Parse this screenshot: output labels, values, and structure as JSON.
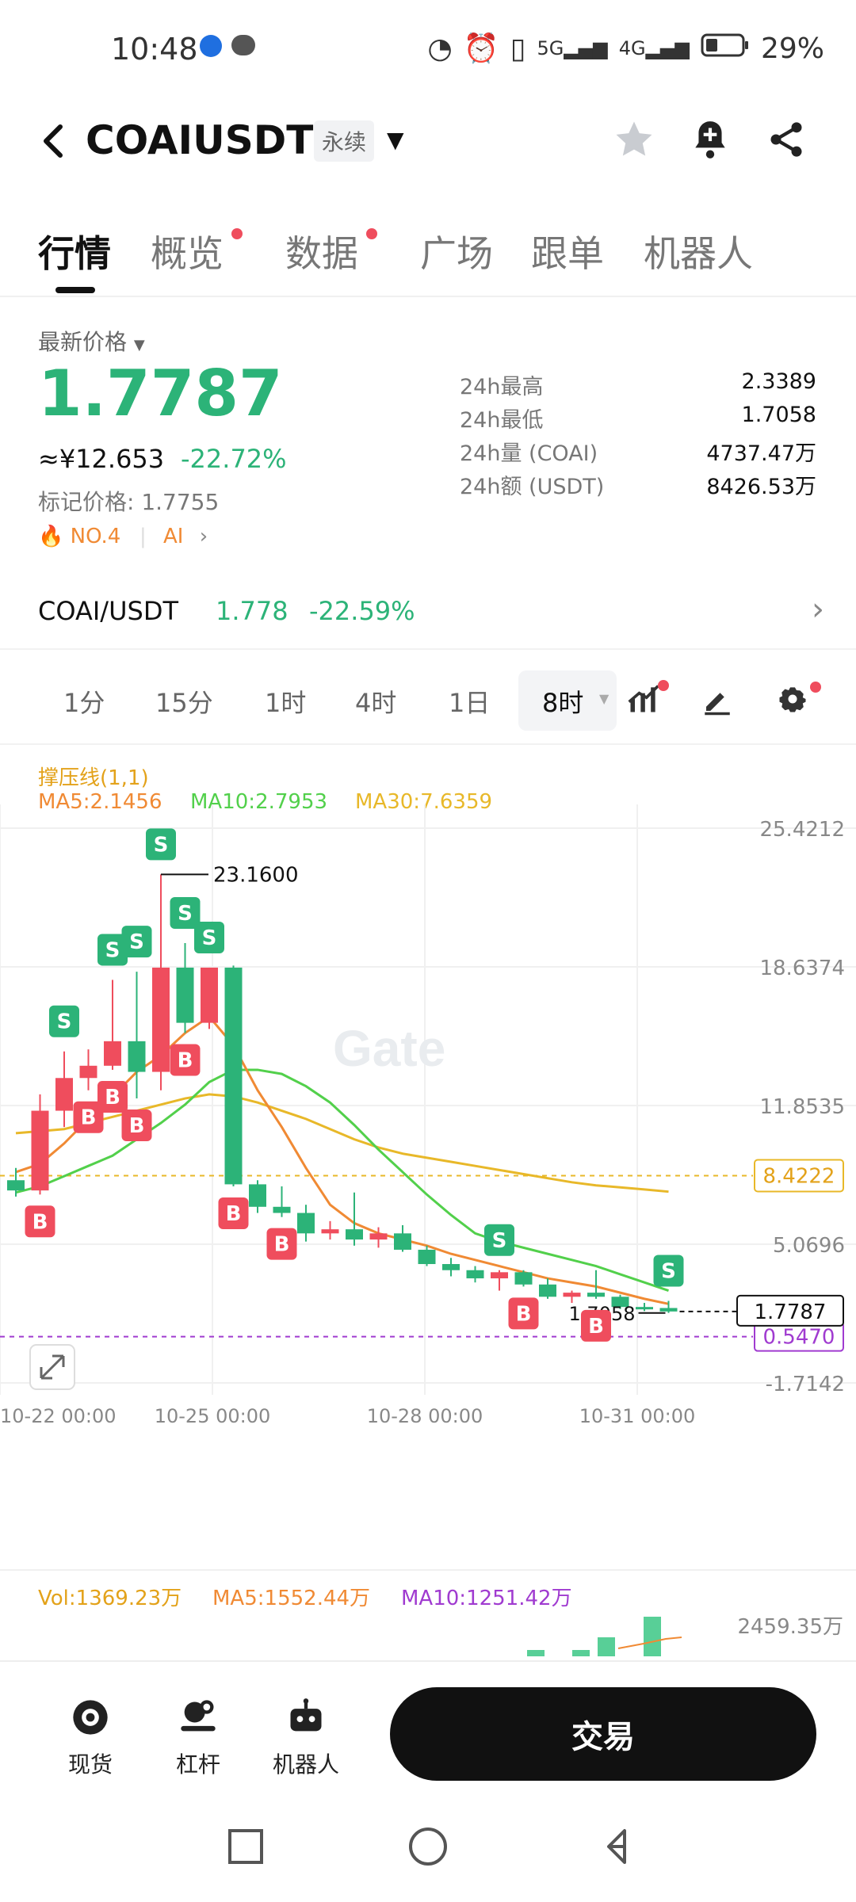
{
  "status_bar": {
    "time": "10:48",
    "battery": "29%"
  },
  "header": {
    "title": "COAIUSDT",
    "badge": "永续"
  },
  "tabs": [
    {
      "label": "行情",
      "active": true,
      "dot": false
    },
    {
      "label": "概览",
      "active": false,
      "dot": true
    },
    {
      "label": "数据",
      "active": false,
      "dot": true
    },
    {
      "label": "广场",
      "active": false,
      "dot": false
    },
    {
      "label": "跟单",
      "active": false,
      "dot": false
    },
    {
      "label": "机器人",
      "active": false,
      "dot": false
    }
  ],
  "price": {
    "latest_label": "最新价格",
    "value": "1.7787",
    "cny": "≈¥12.653",
    "change": "-22.72%",
    "mark_price": "标记价格: 1.7755",
    "tag_rank": "NO.4",
    "tag_sector": "AI"
  },
  "stats": [
    {
      "label": "24h最高",
      "value": "2.3389"
    },
    {
      "label": "24h最低",
      "value": "1.7058"
    },
    {
      "label": "24h量 (COAI)",
      "value": "4737.47万"
    },
    {
      "label": "24h额 (USDT)",
      "value": "8426.53万"
    }
  ],
  "spot": {
    "pair": "COAI/USDT",
    "price": "1.778",
    "change": "-22.59%"
  },
  "timeframes": [
    "1分",
    "15分",
    "1时",
    "4时",
    "1日",
    "8时"
  ],
  "active_timeframe": "8时",
  "indicators": {
    "sr_label": "撑压线(1,1)",
    "ma5": "MA5:2.1456",
    "ma10": "MA10:2.7953",
    "ma30": "MA30:7.6359"
  },
  "volume_indicators": {
    "vol": "Vol:1369.23万",
    "ma5": "MA5:1552.44万",
    "ma10": "MA10:1251.42万",
    "axis_top": "2459.35万"
  },
  "bottom": {
    "spot": "现货",
    "leverage": "杠杆",
    "robot": "机器人",
    "trade": "交易"
  },
  "watermark": "Gate",
  "colors": {
    "up": "#2cb378",
    "down": "#ef4d5d",
    "accent_orange": "#f08a34"
  },
  "chart_data": {
    "type": "candlestick",
    "y_axis_ticks": [
      "25.4212",
      "18.6374",
      "11.8535",
      "5.0696",
      "-1.7142"
    ],
    "x_axis_ticks": [
      "10-22 00:00",
      "10-25 00:00",
      "10-28 00:00",
      "10-31 00:00"
    ],
    "high_label": "23.1600",
    "low_label": "1.7058",
    "current_price_label": "1.7787",
    "support_line_label": "8.4222",
    "purple_line_label": "0.5470",
    "ylim": [
      -1.7142,
      25.4212
    ],
    "candles": [
      {
        "o": 8.2,
        "h": 8.8,
        "l": 7.4,
        "c": 7.7
      },
      {
        "o": 7.7,
        "h": 12.4,
        "l": 7.5,
        "c": 11.6
      },
      {
        "o": 11.6,
        "h": 14.5,
        "l": 10.8,
        "c": 13.2
      },
      {
        "o": 13.2,
        "h": 14.6,
        "l": 12.6,
        "c": 13.8
      },
      {
        "o": 13.8,
        "h": 18.0,
        "l": 13.6,
        "c": 15.0
      },
      {
        "o": 15.0,
        "h": 18.4,
        "l": 12.2,
        "c": 13.5
      },
      {
        "o": 13.5,
        "h": 23.16,
        "l": 12.6,
        "c": 18.6
      },
      {
        "o": 18.6,
        "h": 19.8,
        "l": 15.4,
        "c": 15.9
      },
      {
        "o": 15.9,
        "h": 18.6,
        "l": 15.6,
        "c": 18.6
      },
      {
        "o": 18.6,
        "h": 18.7,
        "l": 7.9,
        "c": 8.0
      },
      {
        "o": 8.0,
        "h": 8.2,
        "l": 6.6,
        "c": 6.9
      },
      {
        "o": 6.9,
        "h": 7.9,
        "l": 6.4,
        "c": 6.6
      },
      {
        "o": 6.6,
        "h": 7.0,
        "l": 5.2,
        "c": 5.6
      },
      {
        "o": 5.6,
        "h": 6.2,
        "l": 5.3,
        "c": 5.8
      },
      {
        "o": 5.8,
        "h": 7.6,
        "l": 5.0,
        "c": 5.3
      },
      {
        "o": 5.3,
        "h": 5.9,
        "l": 4.9,
        "c": 5.6
      },
      {
        "o": 5.6,
        "h": 6.0,
        "l": 4.7,
        "c": 4.8
      },
      {
        "o": 4.8,
        "h": 5.0,
        "l": 4.0,
        "c": 4.1
      },
      {
        "o": 4.1,
        "h": 4.4,
        "l": 3.5,
        "c": 3.8
      },
      {
        "o": 3.8,
        "h": 4.0,
        "l": 3.2,
        "c": 3.4
      },
      {
        "o": 3.4,
        "h": 3.8,
        "l": 2.8,
        "c": 3.7
      },
      {
        "o": 3.7,
        "h": 3.8,
        "l": 3.0,
        "c": 3.1
      },
      {
        "o": 3.1,
        "h": 3.4,
        "l": 2.4,
        "c": 2.5
      },
      {
        "o": 2.5,
        "h": 2.8,
        "l": 2.2,
        "c": 2.7
      },
      {
        "o": 2.7,
        "h": 3.8,
        "l": 2.4,
        "c": 2.5
      },
      {
        "o": 2.5,
        "h": 2.6,
        "l": 1.9,
        "c": 2.0
      },
      {
        "o": 2.0,
        "h": 2.2,
        "l": 1.8,
        "c": 1.95
      },
      {
        "o": 1.95,
        "h": 2.3,
        "l": 1.71,
        "c": 1.78
      }
    ],
    "ma5": [
      8.6,
      9.0,
      10.0,
      11.2,
      12.3,
      13.5,
      14.3,
      15.4,
      16.2,
      14.8,
      12.6,
      10.8,
      8.8,
      7.0,
      6.1,
      5.6,
      5.3,
      5.0,
      4.6,
      4.3,
      4.0,
      3.7,
      3.4,
      3.2,
      3.0,
      2.7,
      2.4,
      2.15
    ],
    "ma10": [
      7.6,
      7.9,
      8.4,
      8.9,
      9.4,
      10.2,
      11.0,
      11.9,
      13.0,
      13.6,
      13.6,
      13.4,
      12.8,
      12.0,
      10.9,
      9.7,
      8.6,
      7.5,
      6.5,
      5.6,
      5.2,
      4.9,
      4.6,
      4.3,
      4.0,
      3.6,
      3.2,
      2.8
    ],
    "ma30": [
      10.5,
      10.6,
      10.7,
      11.0,
      11.3,
      11.6,
      11.9,
      12.2,
      12.4,
      12.3,
      12.0,
      11.6,
      11.2,
      10.7,
      10.2,
      9.8,
      9.5,
      9.3,
      9.1,
      8.9,
      8.7,
      8.5,
      8.3,
      8.1,
      7.95,
      7.85,
      7.75,
      7.64
    ],
    "markers": [
      {
        "i": 4,
        "type": "S"
      },
      {
        "i": 5,
        "type": "S"
      },
      {
        "i": 6,
        "type": "S"
      },
      {
        "i": 7,
        "type": "S"
      },
      {
        "i": 8,
        "type": "S"
      },
      {
        "i": 2,
        "type": "S"
      },
      {
        "i": 1,
        "type": "B"
      },
      {
        "i": 3,
        "type": "B"
      },
      {
        "i": 4,
        "type": "B"
      },
      {
        "i": 5,
        "type": "B"
      },
      {
        "i": 7,
        "type": "B"
      },
      {
        "i": 9,
        "type": "B"
      },
      {
        "i": 11,
        "type": "B"
      },
      {
        "i": 20,
        "type": "S"
      },
      {
        "i": 21,
        "type": "B"
      },
      {
        "i": 24,
        "type": "B"
      },
      {
        "i": 27,
        "type": "S"
      }
    ]
  }
}
